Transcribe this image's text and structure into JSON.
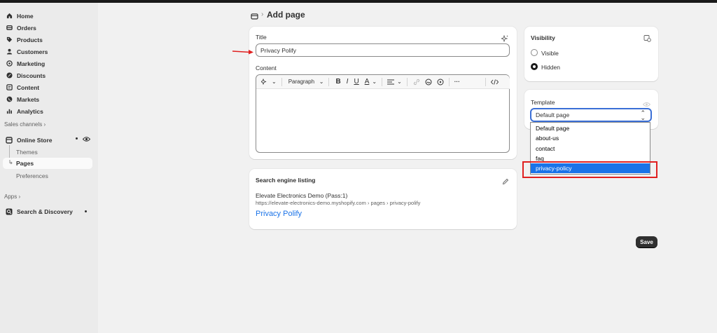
{
  "sidebar": {
    "items": [
      {
        "label": "Home",
        "icon": "home-icon"
      },
      {
        "label": "Orders",
        "icon": "orders-icon"
      },
      {
        "label": "Products",
        "icon": "tag-icon"
      },
      {
        "label": "Customers",
        "icon": "person-icon"
      },
      {
        "label": "Marketing",
        "icon": "target-icon"
      },
      {
        "label": "Discounts",
        "icon": "discount-icon"
      },
      {
        "label": "Content",
        "icon": "content-icon"
      },
      {
        "label": "Markets",
        "icon": "globe-icon"
      },
      {
        "label": "Analytics",
        "icon": "bar-chart-icon"
      }
    ],
    "sales_channels_label": "Sales channels",
    "online_store": "Online Store",
    "sub_items": {
      "themes": "Themes",
      "pages": "Pages",
      "preferences": "Preferences"
    },
    "apps_label": "Apps",
    "search_discovery": "Search & Discovery"
  },
  "header": {
    "title": "Add page"
  },
  "page_form": {
    "title_label": "Title",
    "title_value": "Privacy Polify",
    "content_label": "Content",
    "paragraph_select": "Paragraph"
  },
  "seo": {
    "heading": "Search engine listing",
    "store_name": "Elevate Electronics Demo (Pass:1)",
    "url": "https://elevate-electronics-demo.myshopify.com › pages › privacy-polify",
    "page_title": "Privacy Polify"
  },
  "visibility": {
    "heading": "Visibility",
    "options": [
      "Visible",
      "Hidden"
    ],
    "selected": "Hidden"
  },
  "template": {
    "heading": "Template",
    "selected_value": "Default page",
    "options": [
      "Default page",
      "about-us",
      "contact",
      "faq",
      "privacy-policy"
    ],
    "highlighted": "privacy-policy"
  },
  "actions": {
    "save_label": "Save"
  },
  "colors": {
    "accent": "#1a73e8",
    "annotation": "#e02020",
    "primary_button": "#303030"
  }
}
